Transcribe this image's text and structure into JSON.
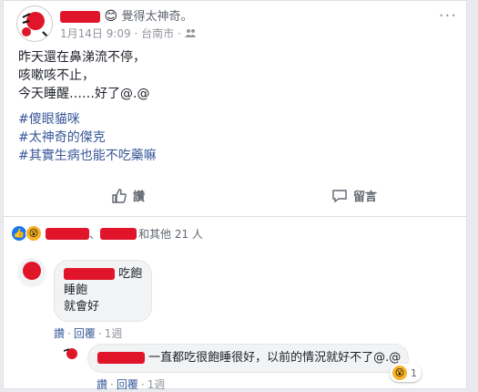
{
  "post": {
    "feeling": "覺得太神奇。",
    "date": "1月14日 9:09",
    "place": "台南市",
    "more": "···",
    "lines": [
      "昨天還在鼻涕流不停，",
      "咳嗽咳不止，",
      "今天睡醒……好了@.@"
    ],
    "hashtags": [
      "#傻眼貓咪",
      "#太神奇的傑克",
      "#其實生病也能不吃藥嘛"
    ]
  },
  "actions": {
    "like": "讚",
    "comment": "留言"
  },
  "reactions": {
    "summary": "和其他 21 人",
    "separator": "、"
  },
  "comments": [
    {
      "text_inline": "吃飽",
      "lines": [
        "睡飽",
        "就會好"
      ],
      "like": "讚",
      "reply": "回覆",
      "time": "1週"
    }
  ],
  "reply": {
    "text": "一直都吃很飽睡很好，以前的情況就好不了@.@",
    "like": "讚",
    "reply": "回覆",
    "time": "1週",
    "react_count": "1"
  },
  "colors": {
    "redact": "#e0152a",
    "link": "#385898",
    "like_blue": "#1877f2",
    "wow_yellow": "#f7b125"
  }
}
